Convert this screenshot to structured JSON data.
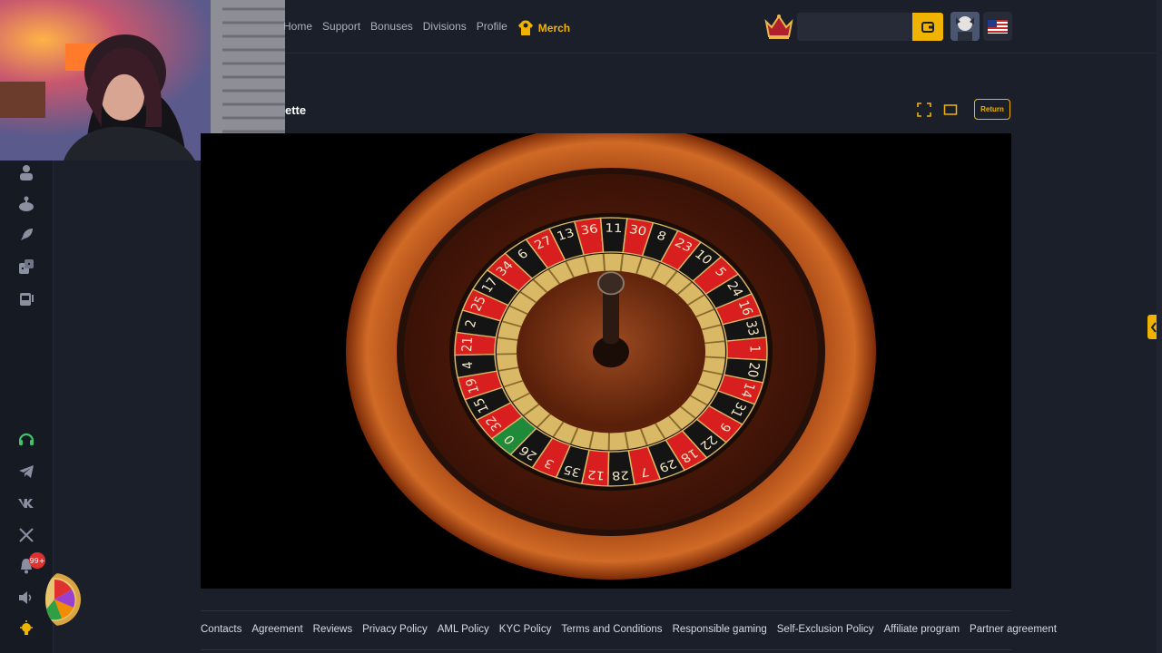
{
  "nav": {
    "items": [
      "Home",
      "Support",
      "Bonuses",
      "Divisions",
      "Profile"
    ],
    "merch_label": "Merch"
  },
  "sidebar": {
    "icons": [
      "user-icon",
      "joystick-icon",
      "rocket-icon",
      "dice-icon",
      "slot-machine-icon"
    ],
    "bottom_icons": [
      "support-headset-icon",
      "telegram-icon",
      "vk-icon",
      "x-icon",
      "bell-icon",
      "speaker-icon",
      "lightbulb-icon"
    ],
    "notification_count": "99+"
  },
  "game": {
    "title_visible": "ette",
    "return_label": "Return",
    "wheel_numbers": [
      "0",
      "32",
      "15",
      "19",
      "4",
      "21",
      "2",
      "25",
      "17",
      "34",
      "6",
      "27",
      "13",
      "36",
      "11",
      "30",
      "8",
      "23",
      "10",
      "5",
      "24",
      "16",
      "33",
      "1",
      "20",
      "14",
      "31",
      "9",
      "22",
      "18",
      "29",
      "7",
      "28",
      "12",
      "35",
      "3",
      "26"
    ]
  },
  "footer": {
    "links": [
      "Contacts",
      "Agreement",
      "Reviews",
      "Privacy Policy",
      "AML Policy",
      "KYC Policy",
      "Terms and Conditions",
      "Responsible gaming",
      "Self-Exclusion Policy",
      "Affiliate program",
      "Partner agreement"
    ]
  },
  "colors": {
    "accent": "#f0b400",
    "background": "#1b1f2a",
    "sidebar": "#161a23"
  }
}
